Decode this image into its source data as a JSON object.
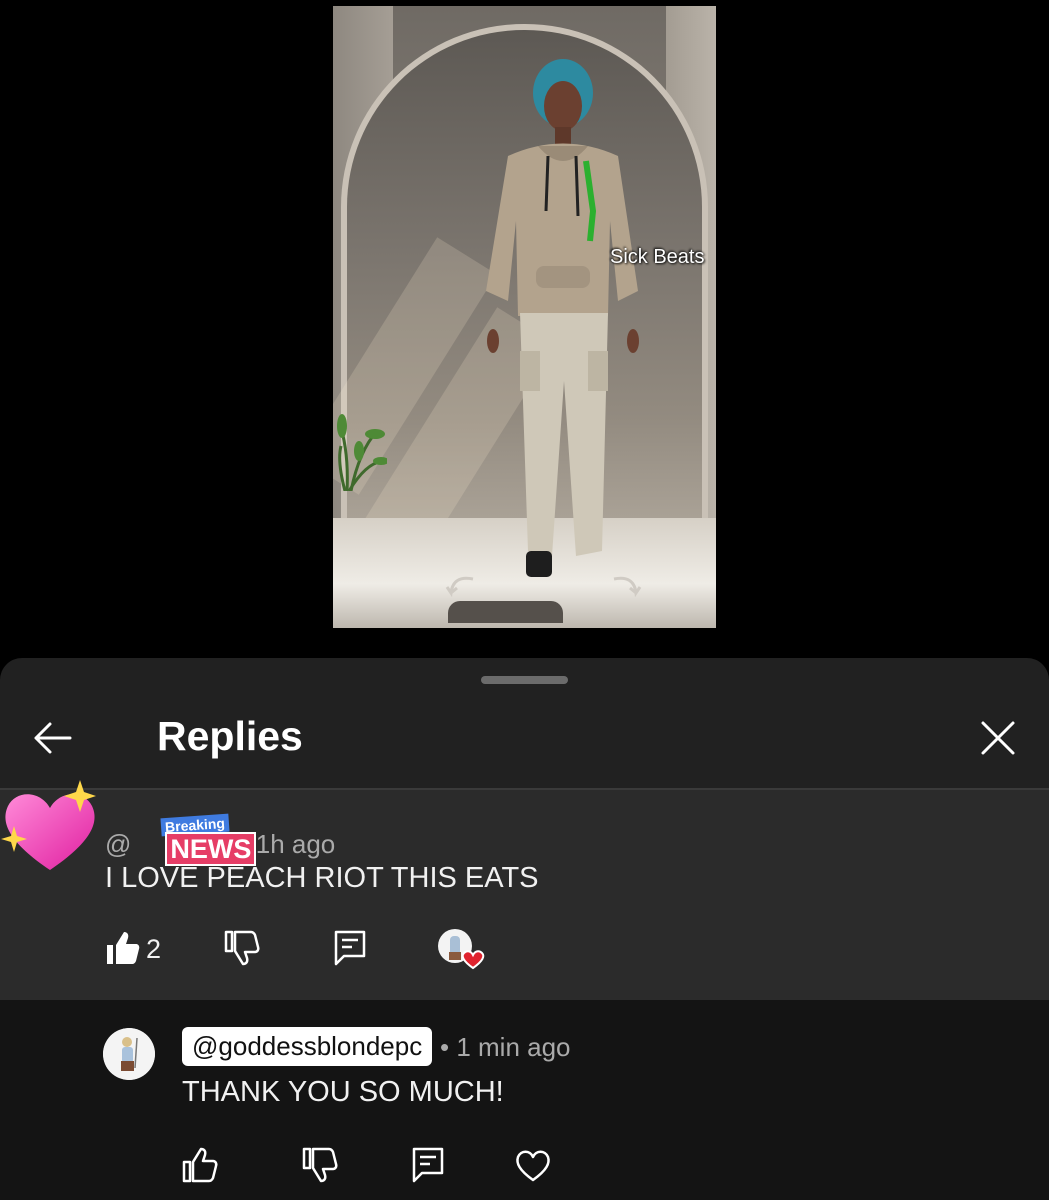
{
  "video": {
    "overlay_text": "Sick Beats"
  },
  "sheet": {
    "title": "Replies",
    "back_icon": "arrow-left-icon",
    "close_icon": "close-icon"
  },
  "parent_comment": {
    "at": "@",
    "badge_top": "Breaking",
    "badge_bottom": "NEWS",
    "time": "• 1h ago",
    "text": "I LOVE PEACH RIOT THIS EATS",
    "like_count": "2",
    "avatar_icon": "sparkling-heart-icon"
  },
  "reply": {
    "handle": "@goddessblondepc",
    "time": "• 1 min ago",
    "text": "THANK YOU SO MUCH!"
  },
  "colors": {
    "sheet_bg": "#212121",
    "parent_bg": "#2b2b2b",
    "reply_bg": "#141414",
    "news_pink": "#e63d66",
    "breaking_blue": "#3f7be0"
  }
}
